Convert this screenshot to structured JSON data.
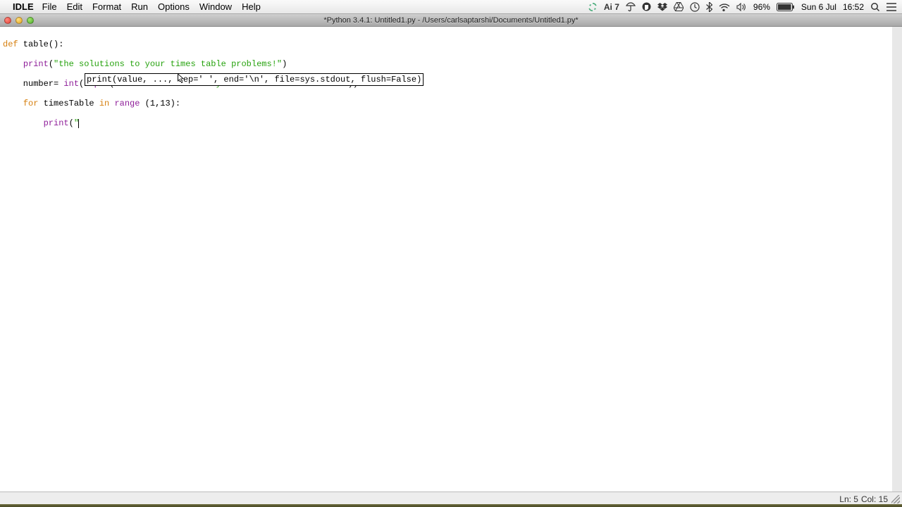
{
  "menubar": {
    "app": "IDLE",
    "items": [
      "File",
      "Edit",
      "Format",
      "Run",
      "Options",
      "Window",
      "Help"
    ],
    "ai_label": "Ai 7",
    "battery": "96%",
    "date": "Sun 6 Jul",
    "time": "16:52"
  },
  "window": {
    "title": "*Python 3.4.1: Untitled1.py - /Users/carlsaptarshi/Documents/Untitled1.py*"
  },
  "code": {
    "l1": {
      "a": "def",
      "b": " table():"
    },
    "l2": {
      "a": "    ",
      "b": "print",
      "c": "(",
      "d": "\"the solutions to your times table problems!\"",
      "e": ")"
    },
    "l3": {
      "a": "    number= ",
      "b": "int",
      "c": "(",
      "d": "input",
      "e": "(",
      "f": "\"what is the number you would like to times? \"",
      "g": "))"
    },
    "l4": {
      "a": "    ",
      "b": "for",
      "c": " timesTable ",
      "d": "in",
      "e": " ",
      "f": "range",
      "g": " (1,13):"
    },
    "l5": {
      "a": "        ",
      "b": "print",
      "c": "(",
      "d": "\""
    }
  },
  "calltip": "print(value, ..., sep=' ', end='\\n', file=sys.stdout, flush=False)",
  "status": {
    "ln": "Ln: 5",
    "col": "Col: 15"
  }
}
